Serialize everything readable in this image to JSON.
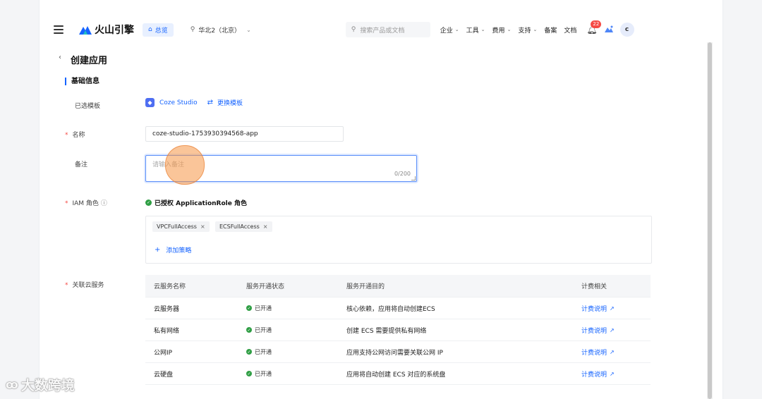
{
  "header": {
    "brand": "火山引擎",
    "home_label": "总览",
    "region": "华北2（北京）",
    "search_placeholder": "搜索产品或文档",
    "nav": [
      {
        "label": "企业",
        "dropdown": true
      },
      {
        "label": "工具",
        "dropdown": true
      },
      {
        "label": "费用",
        "dropdown": true
      },
      {
        "label": "支持",
        "dropdown": true
      },
      {
        "label": "备案",
        "dropdown": false
      },
      {
        "label": "文档",
        "dropdown": false
      }
    ],
    "notification_count": "22",
    "avatar_letter": "c"
  },
  "page": {
    "back_symbol": "‹",
    "title": "创建应用"
  },
  "basic_info": {
    "section_title": "基础信息",
    "template_label": "已选模板",
    "template_name": "Coze Studio",
    "change_template": "更换模板",
    "name_label": "名称",
    "name_value": "coze-studio-1753930394568-app",
    "note_label": "备注",
    "note_placeholder": "请输入备注",
    "note_counter": "0/200",
    "iam_label": "IAM 角色",
    "iam_status": "已授权 ApplicationRole 角色",
    "policies": [
      "VPCFullAccess",
      "ECSFullAccess"
    ],
    "add_policy": "添加策略",
    "services_label": "关联云服务"
  },
  "services_table": {
    "headers": [
      "云服务名称",
      "服务开通状态",
      "服务开通目的",
      "计费相关"
    ],
    "rows": [
      {
        "name": "云服务器",
        "status": "已开通",
        "purpose": "核心依赖，应用将自动创建ECS",
        "fee": "计费说明"
      },
      {
        "name": "私有网络",
        "status": "已开通",
        "purpose": "创建 ECS 需要提供私有网络",
        "fee": "计费说明"
      },
      {
        "name": "公网IP",
        "status": "已开通",
        "purpose": "应用支持公网访问需要关联公网 IP",
        "fee": "计费说明"
      },
      {
        "name": "云硬盘",
        "status": "已开通",
        "purpose": "应用将自动创建 ECS 对应的系统盘",
        "fee": "计费说明"
      }
    ]
  },
  "watermark": "大数跨境",
  "colors": {
    "accent": "#1664ff",
    "required": "#f54a45",
    "success": "#2f9e44",
    "badge": "#f54a45"
  }
}
